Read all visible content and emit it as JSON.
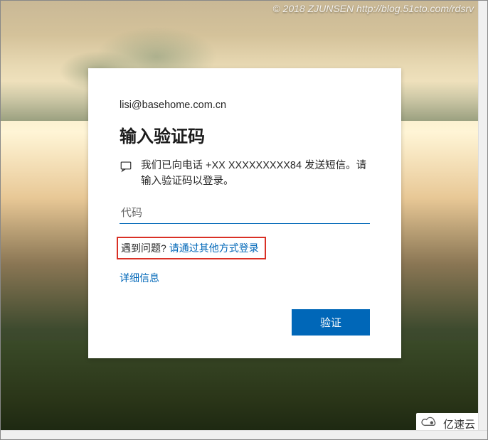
{
  "watermark": "© 2018 ZJUNSEN http://blog.51cto.com/rdsrv",
  "card": {
    "email": "lisi@basehome.com.cn",
    "title": "输入验证码",
    "sms_text": "我们已向电话 +XX XXXXXXXXX84 发送短信。请输入验证码以登录。",
    "code_placeholder": "代码",
    "trouble_label": "遇到问题?",
    "trouble_link": "请通过其他方式登录",
    "more_info": "详细信息",
    "verify_btn": "验证"
  },
  "brandmark": "亿速云",
  "icons": {
    "sms": "sms-icon",
    "cloud": "cloud-logo-icon"
  }
}
